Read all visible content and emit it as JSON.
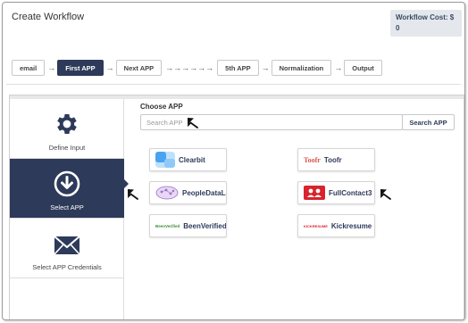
{
  "header": {
    "title": "Create Workflow",
    "cost_label": "Workflow Cost: $",
    "cost_value": "0"
  },
  "steps": [
    {
      "label": "email",
      "active": false
    },
    {
      "label": "First APP",
      "active": true
    },
    {
      "label": "Next APP",
      "active": false
    },
    {
      "label": "5th APP",
      "active": false
    },
    {
      "label": "Normalization",
      "active": false
    },
    {
      "label": "Output",
      "active": false
    }
  ],
  "step_arrow": "→",
  "step_arrows_long": "→→→→→→",
  "sidebar": {
    "items": [
      {
        "label": "Define Input",
        "icon": "gear-icon"
      },
      {
        "label": "Select APP",
        "icon": "download-circle-icon"
      },
      {
        "label": "Select APP Credentials",
        "icon": "envelope-icon"
      }
    ]
  },
  "main": {
    "choose_label": "Choose APP",
    "search_placeholder": "Search APP",
    "search_button": "Search APP",
    "apps": [
      {
        "name": "Clearbit",
        "logo_text": ""
      },
      {
        "name": "Toofr",
        "logo_text": "Toofr"
      },
      {
        "name": "PeopleDataLabs",
        "logo_text": ""
      },
      {
        "name": "FullContact3",
        "logo_text": ""
      },
      {
        "name": "BeenVerified",
        "logo_text": "BeenVerified"
      },
      {
        "name": "Kickresume",
        "logo_text": "KICKRESUME"
      }
    ]
  },
  "colors": {
    "accent": "#2e3a59",
    "cost_bg": "#e4e8ec",
    "fullcontact_red": "#d9232d",
    "clearbit_blue": "#4aa3f0",
    "toofr_red": "#d9534f",
    "pdl_purple": "#9c6fc9",
    "beenverified_green": "#3a8d3a"
  }
}
